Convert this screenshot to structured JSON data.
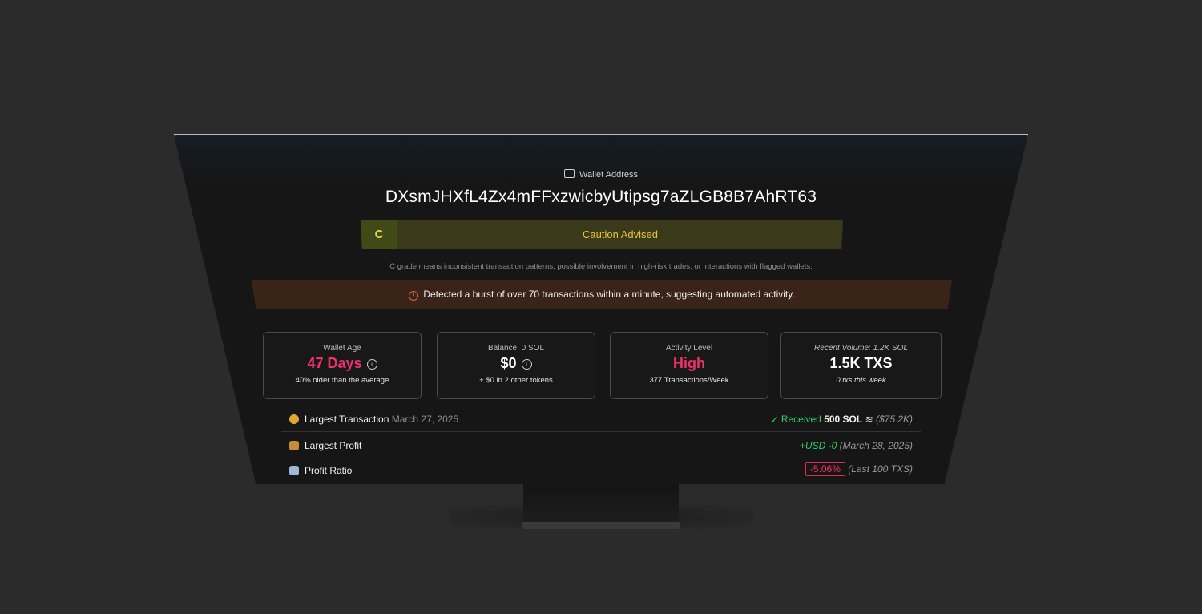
{
  "wallet": {
    "label": "Wallet Address",
    "address": "DXsmJHXfL4Zx4mFFxzwicbyUtipsg7aZLGB8B7AhRT63"
  },
  "grade": {
    "letter": "C",
    "status": "Caution Advised",
    "note": "C grade means inconsistent transaction patterns, possible involvement in high-risk trades, or interactions with flagged wallets."
  },
  "alert": {
    "message": "Detected a burst of over 70 transactions within a minute, suggesting automated activity."
  },
  "cards": [
    {
      "label": "Wallet Age",
      "value": "47 Days",
      "sub": "40% older than the average"
    },
    {
      "label": "Balance: 0 SOL",
      "value": "$0",
      "sub": "+ $0 in 2 other tokens"
    },
    {
      "label": "Activity Level",
      "value": "High",
      "sub": "377 Transactions/Week"
    },
    {
      "label": "Recent Volume: 1.2K SOL",
      "value": "1.5K TXS",
      "sub": "0 txs this week"
    }
  ],
  "rows": {
    "largest_tx": {
      "label": "Largest Transaction",
      "date": "March 27, 2025",
      "direction": "Received",
      "amount": "500 SOL",
      "usd": "($75.2K)"
    },
    "largest_profit": {
      "label": "Largest Profit",
      "value": "+USD -0",
      "date": "(March 28, 2025)"
    },
    "profit_ratio": {
      "label": "Profit Ratio",
      "value": "-5.06%",
      "note": "(Last 100 TXS)"
    }
  },
  "colors": {
    "accent_pink": "#f0306a",
    "caution_yellow": "#e6c43a",
    "positive_green": "#33cc66",
    "alert_orange": "#e0663c"
  }
}
